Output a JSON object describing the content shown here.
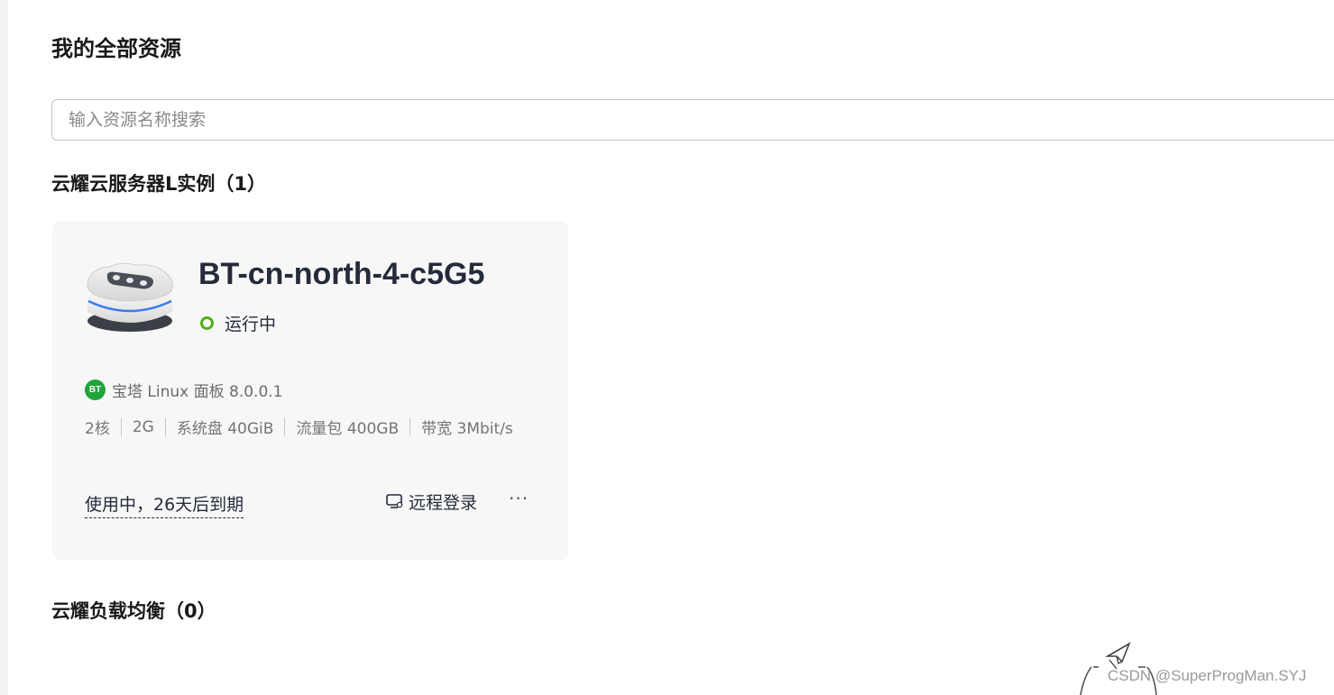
{
  "page": {
    "title": "我的全部资源"
  },
  "search": {
    "placeholder": "输入资源名称搜索",
    "value": ""
  },
  "sections": {
    "instances": {
      "title": "云耀云服务器L实例（1）"
    },
    "load_balancers": {
      "title": "云耀负载均衡（0）"
    }
  },
  "instance_card": {
    "name": "BT-cn-north-4-c5G5",
    "status": "运行中",
    "status_color": "#50b017",
    "app_badge": "BT",
    "app_name": "宝塔 Linux 面板 8.0.0.1",
    "specs": [
      "2核",
      "2G",
      "系统盘 40GiB",
      "流量包 400GB",
      "带宽 3Mbit/s"
    ],
    "expiry": "使用中，26天后到期",
    "remote_login_label": "远程登录",
    "more_label": "···"
  },
  "watermark": "CSDN @SuperProgMan.SYJ"
}
